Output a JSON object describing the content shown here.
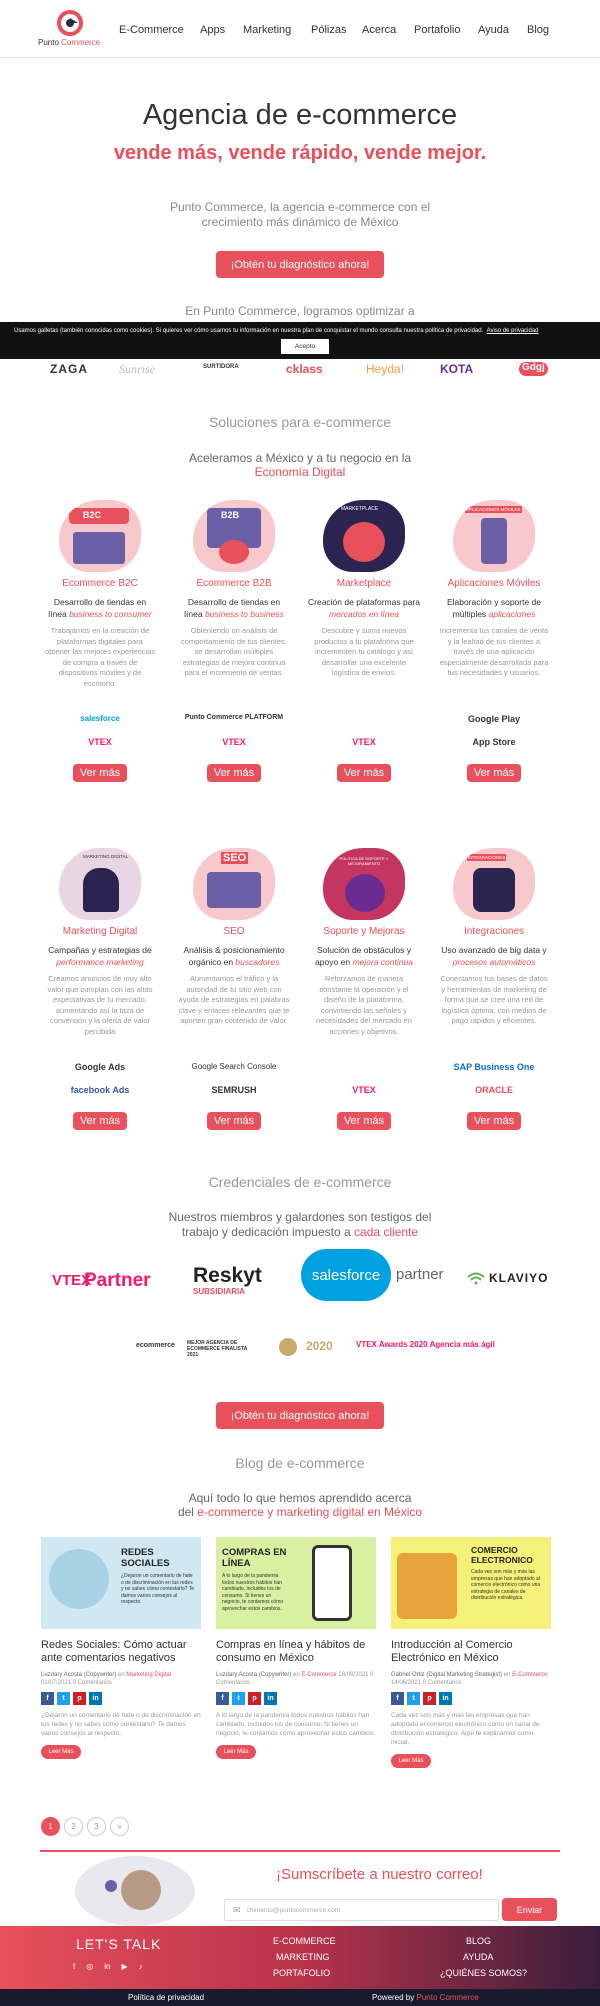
{
  "brand": {
    "name1": "Punto",
    "name2": "Commerce"
  },
  "nav": [
    "E-Commerce",
    "Apps",
    "Marketing",
    "Pólizas",
    "Acerca",
    "Portafolio",
    "Ayuda",
    "Blog"
  ],
  "hero": {
    "title": "Agencia de e-commerce",
    "slogan": "vende más, vende rápido, vende mejor.",
    "lead": "Punto Commerce, la agencia e-commerce con el crecimiento más dinámico de México",
    "cta": "¡Obtén tu diagnóstico ahora!",
    "intro": "En Punto Commerce, logramos optimizar a"
  },
  "cookie": {
    "text": "Usamos galletas (también conocidas como cookies). Si quieres ver cómo usamos tu información en nuestra plan de conquistar el mundo consulta nuestra política de privacidad.",
    "link": "Aviso de privacidad",
    "accept": "Acepto"
  },
  "clients": [
    "ZAGA",
    "Sunrise",
    "SURTIDORA",
    "cklass",
    "Heyda!",
    "KOTA",
    "Gdgj"
  ],
  "solutions": {
    "heading": "Soluciones para e-commerce",
    "sub1": "Aceleramos a México y a tu negocio en la",
    "sub2": "Economía Digital",
    "more": "Ver más",
    "cards": [
      {
        "title": "Ecommerce B2C",
        "s1": "Desarrollo de tiendas en línea",
        "s2": "business to consumer",
        "desc": "Trabajamos en la creación de plataformas digitales para obtener las mejores experiencias de compra a través de dispositivos móviles y de escritorio.",
        "p1": "salesforce",
        "p2": "VTEX",
        "ill": "B2C"
      },
      {
        "title": "Ecommerce B2B",
        "s1": "Desarrollo de tiendas en línea",
        "s2": "business to business",
        "desc": "Obteniendo un análisis de comportamiento de tus clientes, se desarrollan múltiples estrategias de mejora continua para el incremento de ventas.",
        "p1": "Punto Commerce PLATFORM",
        "p2": "VTEX",
        "ill": "B2B"
      },
      {
        "title": "Marketplace",
        "s1": "Creación de plataformas para",
        "s2": "mercados en línea",
        "desc": "Descubre y suma nuevos productos a tu plataforma que incrementen tu catálogo y así desarrollar una excelente logística de envíos.",
        "p1": "",
        "p2": "VTEX",
        "ill": "MARKETPLACE"
      },
      {
        "title": "Aplicaciones Móviles",
        "s1": "Elaboración y soporte de múltiples",
        "s2": "aplicaciones",
        "desc": "Incrementa tus canales de venta y la lealtad de tus clientes a través de una aplicación especialmente desarrollada para tus necesidades y usuarios.",
        "p1": "Google Play",
        "p2": "App Store",
        "ill": "APLICACIONES MÓVILES"
      },
      {
        "title": "Marketing Digital",
        "s1": "Campañas y estrategias de",
        "s2": "performance marketing",
        "desc": "Creamos anuncios de muy alto valor que cumplan con las altas expectativas de tu mercado, aumentando así la taza de conversión y la oferta de valor percibida",
        "p1": "Google Ads",
        "p2": "facebook Ads",
        "ill": "MARKETING DIGITAL"
      },
      {
        "title": "SEO",
        "s1": "Análisis & posicionamiento orgánico en",
        "s2": "buscadores",
        "desc": "Aumentamos el tráfico y la autoridad de tu sitio web con ayuda de estrategias en palabras clave y enlaces relevantes que te aporten gran contenido de valor.",
        "p1": "Google Search Console",
        "p2": "SEMRUSH",
        "ill": "SEO"
      },
      {
        "title": "Soporte y Mejoras",
        "s1": "Solución de obstáculos y apoyo en",
        "s2": "mejora continua",
        "desc": "Reforzamos de manera constante la operación y el diseño de la plataforma, convirtiendo las señales y necesidades del mercado en acciones y objetivos.",
        "p1": "",
        "p2": "VTEX",
        "ill": "POLITICA DE SOPORTE Y MEJORAMIENTO"
      },
      {
        "title": "Integraciones",
        "s1": "Uso avanzado de big data y",
        "s2": "procesos automáticos",
        "desc": "Conectamos tus bases de datos y herramientas de marketing de forma que se cree una red de logística óptima, con medios de pago rápidos y eficientes.",
        "p1": "SAP Business One",
        "p2": "ORACLE",
        "ill": "INTEGRACIONES"
      }
    ]
  },
  "credentials": {
    "heading": "Credenciales de e-commerce",
    "sub1": "Nuestros miembros y galardones son testigos del",
    "sub2": "trabajo y dedicación impuesto a",
    "sub3": "cada cliente",
    "logos": [
      "VTEX",
      "Partner",
      "Reskyt",
      "SUBSIDIARIA",
      "salesforce",
      "partner",
      "KLAVIYO"
    ],
    "awards": [
      "ecommerce",
      "MEJOR AGENCIA DE ECOMMERCE FINALISTA 2021",
      "2020",
      "VTEX Awards 2020 Agencia más ágil"
    ]
  },
  "cta2": "¡Obtén tu diagnóstico ahora!",
  "blog": {
    "heading": "Blog de e-commerce",
    "sub1": "Aquí todo lo que hemos aprendido acerca",
    "sub2": "del",
    "sub3": "e-commerce y marketing digital en México",
    "more": "Leer Más",
    "posts": [
      {
        "img": "REDES SOCIALES",
        "imgtext": "¿Dejaron un comentario de hate o de discriminación en tus redes y no sabes cómo contestarlo? Te damos varios consejos al respecto.",
        "title": "Redes Sociales: Cómo actuar ante comentarios negativos",
        "author": "Luzdary Acosta (Copywriter)",
        "cat": "Marketing Digital",
        "date": "01/07/2021",
        "comments": "0 Comentarios",
        "excerpt": "¿Dejaron un comentario de hate o de discriminación en tus redes y no sabes cómo contestarlo? Te damos varios consejos al respecto."
      },
      {
        "img": "COMPRAS EN LÍNEA",
        "imgtext": "A lo largo de la pandemia todos nuestros hábitos han cambiado, incluidos los de consumo. Si tienes un negocio, te contamos cómo aprovechar estos cambios.",
        "title": "Compras en línea y hábitos de consumo en México",
        "author": "Luzdary Acosta (Copywriter)",
        "cat": "E-Commerce",
        "date": "28/06/2021",
        "comments": "0 Comentarios",
        "excerpt": "A lo largo de la pandemia todos nuestros hábitos han cambiado, incluidos los de consumo. Si tienes un negocio, te contamos cómo aprovechar estos cambios."
      },
      {
        "img": "COMERCIO ELECTRONICO",
        "imgtext": "Cada vez son más y más las empresas que han adoptado al comercio electrónico como una estrategia de canales de distribución estratégica.",
        "title": "Introducción al Comercio Electrónico en México",
        "author": "Gabriel Ortiz (Digital Marketing Strategist)",
        "cat": "E-Commerce",
        "date": "14/06/2021",
        "comments": "0 Comentarios",
        "excerpt": "Cada vez son más y más las empresas que han adoptado el comercio electrónico como un canal de distribución estratégico. Aquí te explicamos como iniciar."
      }
    ],
    "pages": [
      "1",
      "2",
      "3",
      "»"
    ]
  },
  "newsletter": {
    "title": "¡Sumscríbete a nuestro correo!",
    "placeholder": "chimento@puntocommerce.com",
    "send": "Enviar"
  },
  "footer": {
    "talk": "LET'S TALK",
    "col1": [
      "E-COMMERCE",
      "MARKETING",
      "PORTAFOLIO"
    ],
    "col2": [
      "BLOG",
      "AYUDA",
      "¿QUIÉNES SOMOS?"
    ],
    "privacy": "Política de privacidad",
    "powered": "Powered by",
    "powered2": "Punto Commerce"
  },
  "colors": {
    "accent": "#e8505b"
  }
}
